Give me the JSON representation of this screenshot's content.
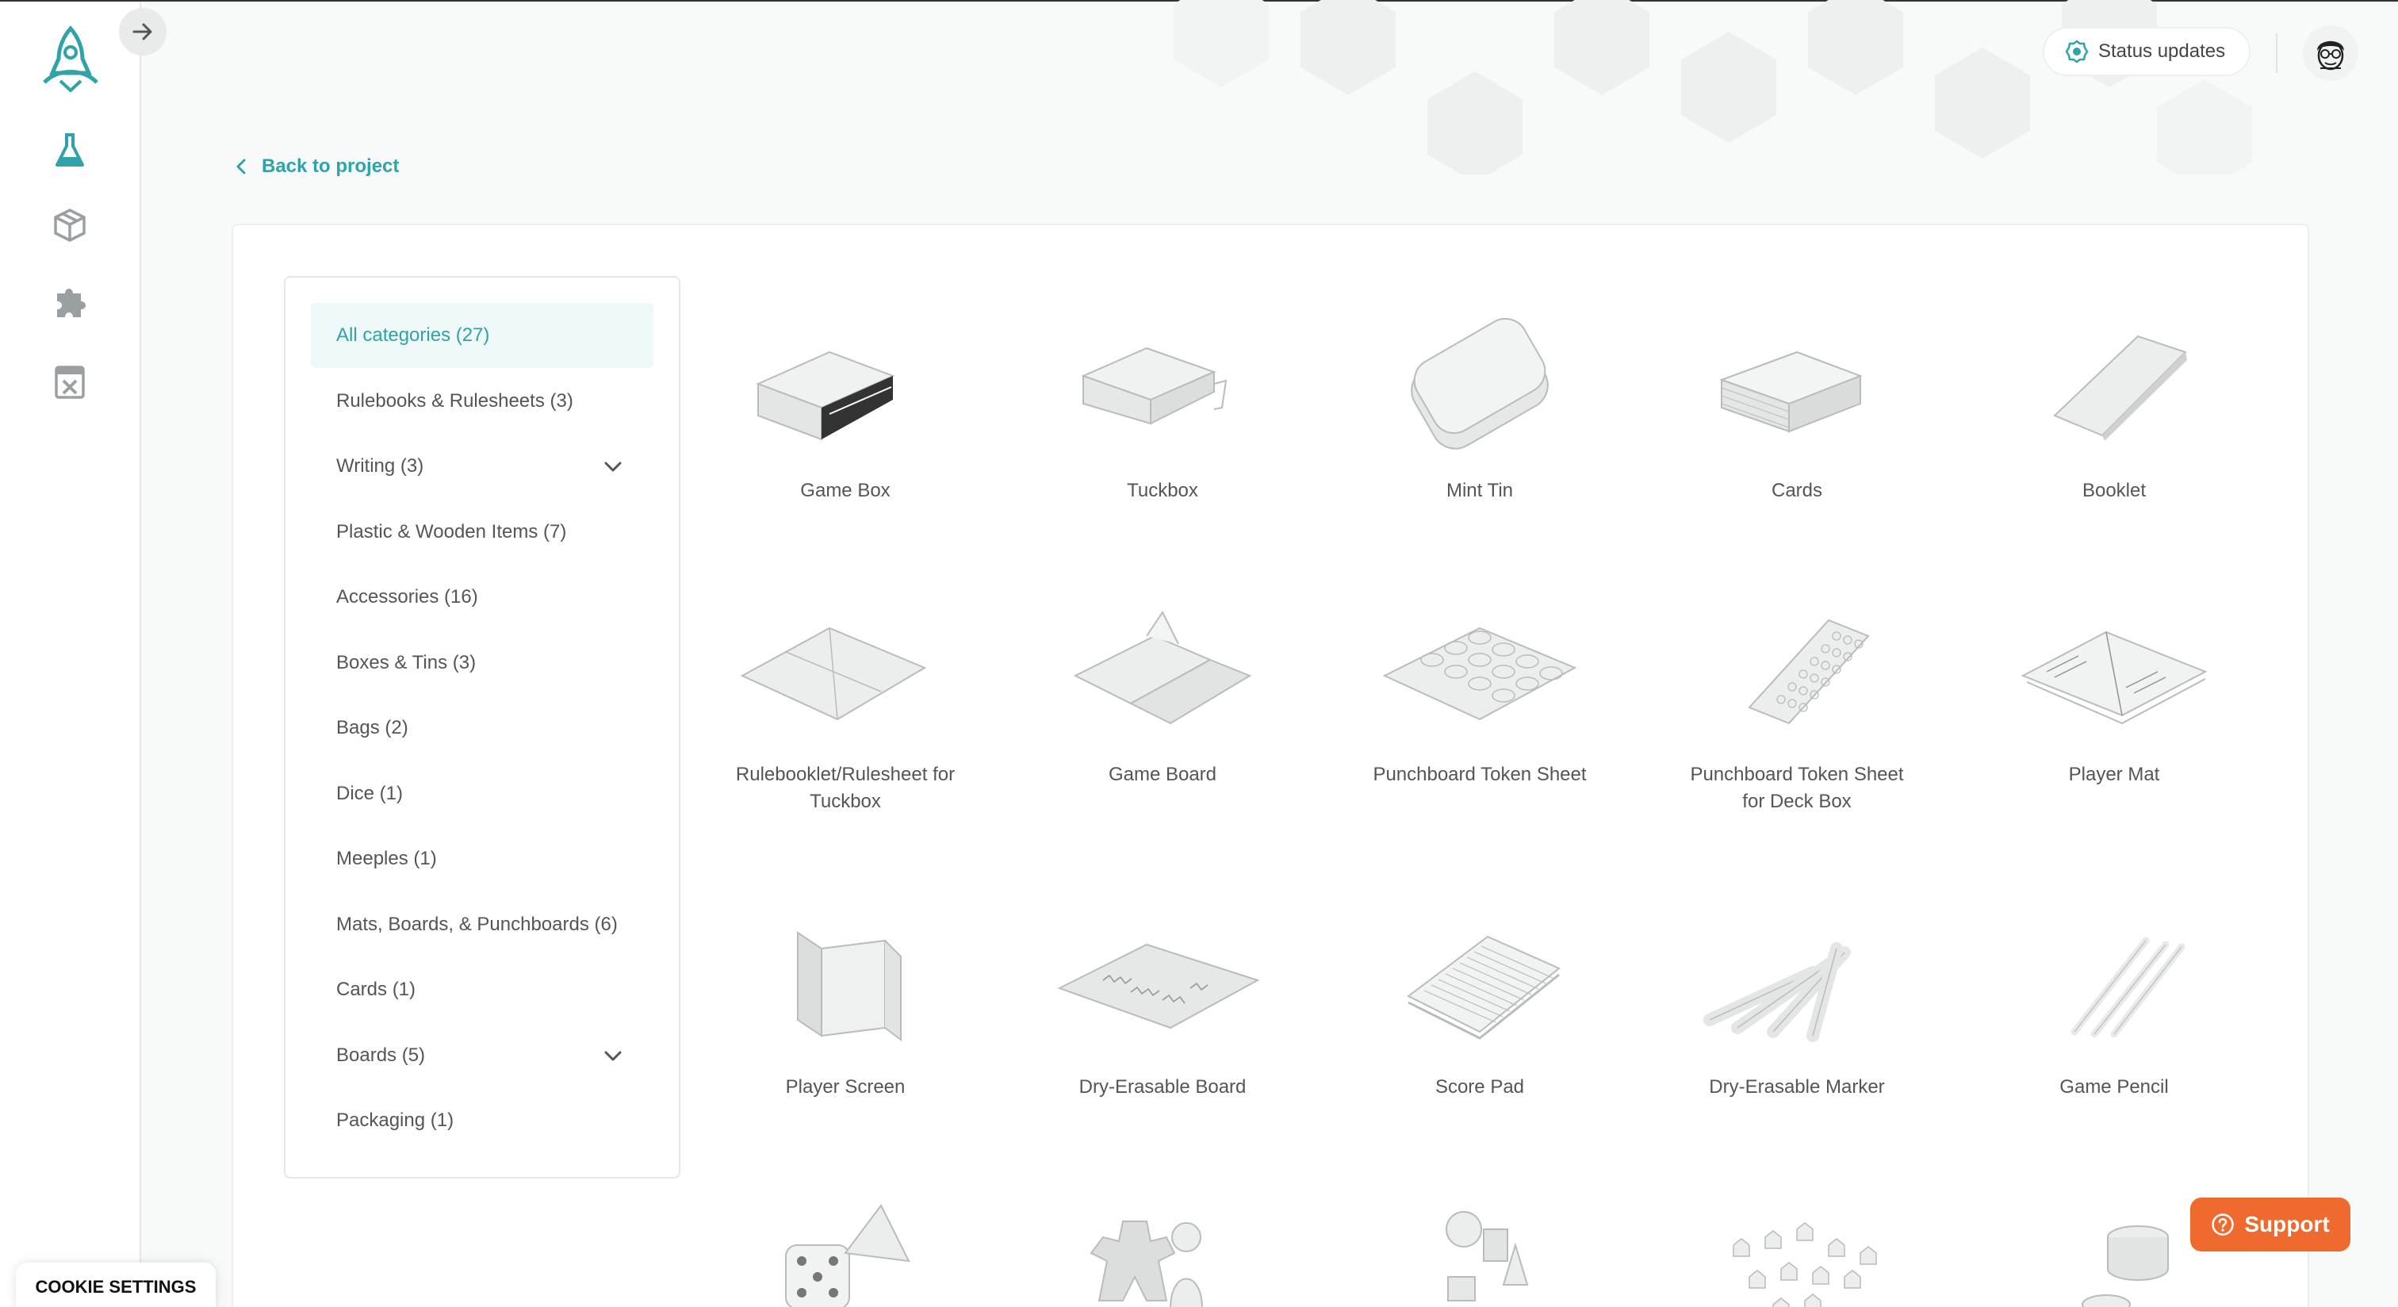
{
  "colors": {
    "accent": "#2fa3a8",
    "support": "#ee6a2f"
  },
  "header": {
    "status_label": "Status updates"
  },
  "nav": {
    "back_label": "Back to project"
  },
  "sidebar": {
    "icons": [
      "flask-icon",
      "box-icon",
      "puzzle-icon",
      "catalog-icon"
    ]
  },
  "categories": [
    {
      "label": "All categories (27)",
      "active": true
    },
    {
      "label": "Rulebooks & Rulesheets (3)"
    },
    {
      "label": "Writing (3)",
      "expandable": true
    },
    {
      "label": "Plastic & Wooden Items (7)"
    },
    {
      "label": "Accessories (16)"
    },
    {
      "label": "Boxes & Tins (3)"
    },
    {
      "label": "Bags (2)"
    },
    {
      "label": "Dice (1)"
    },
    {
      "label": "Meeples (1)"
    },
    {
      "label": "Mats, Boards, & Punchboards (6)"
    },
    {
      "label": "Cards (1)"
    },
    {
      "label": "Boards (5)",
      "expandable": true
    },
    {
      "label": "Packaging (1)"
    }
  ],
  "products": [
    {
      "label": "Game Box",
      "icon": "game-box-icon"
    },
    {
      "label": "Tuckbox",
      "icon": "tuckbox-icon"
    },
    {
      "label": "Mint Tin",
      "icon": "mint-tin-icon"
    },
    {
      "label": "Cards",
      "icon": "cards-icon"
    },
    {
      "label": "Booklet",
      "icon": "booklet-icon"
    },
    {
      "label": "Rulebooklet/Rulesheet for Tuckbox",
      "icon": "rulesheet-icon"
    },
    {
      "label": "Game Board",
      "icon": "game-board-icon"
    },
    {
      "label": "Punchboard Token Sheet",
      "icon": "token-sheet-icon"
    },
    {
      "label": "Punchboard Token Sheet for Deck Box",
      "icon": "token-sheet-deckbox-icon"
    },
    {
      "label": "Player Mat",
      "icon": "player-mat-icon"
    },
    {
      "label": "Player Screen",
      "icon": "player-screen-icon"
    },
    {
      "label": "Dry-Erasable Board",
      "icon": "dry-erase-board-icon"
    },
    {
      "label": "Score Pad",
      "icon": "score-pad-icon"
    },
    {
      "label": "Dry-Erasable Marker",
      "icon": "marker-icon"
    },
    {
      "label": "Game Pencil",
      "icon": "pencil-icon"
    },
    {
      "label": "",
      "icon": "dice-icon"
    },
    {
      "label": "",
      "icon": "meeple-icon"
    },
    {
      "label": "",
      "icon": "plastic-pieces-icon"
    },
    {
      "label": "",
      "icon": "wooden-pieces-icon"
    },
    {
      "label": "",
      "icon": "coins-icon"
    }
  ],
  "support": {
    "label": "Support"
  },
  "cookie": {
    "label": "COOKIE SETTINGS"
  }
}
